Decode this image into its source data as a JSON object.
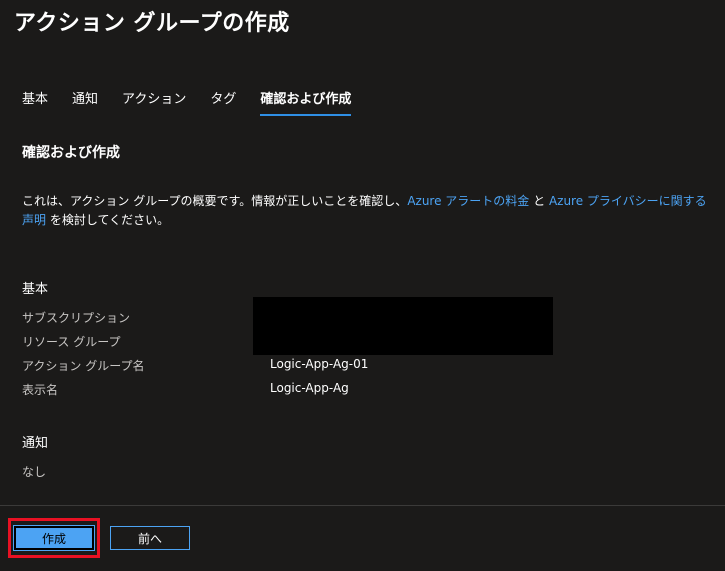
{
  "header": {
    "title": "アクション グループの作成"
  },
  "tabs": [
    {
      "label": "基本",
      "active": false
    },
    {
      "label": "通知",
      "active": false
    },
    {
      "label": "アクション",
      "active": false
    },
    {
      "label": "タグ",
      "active": false
    },
    {
      "label": "確認および作成",
      "active": true
    }
  ],
  "section": {
    "heading": "確認および作成"
  },
  "description": {
    "part1": "これは、アクション グループの概要です。情報が正しいことを確認し、",
    "link1": "Azure アラートの料金",
    "part2": " と ",
    "link2": "Azure プライバシーに関する声明",
    "part3": " を検討してください。"
  },
  "basics": {
    "title": "基本",
    "fields": [
      {
        "label": "サブスクリプション",
        "value": ""
      },
      {
        "label": "リソース グループ",
        "value": ""
      },
      {
        "label": "アクション グループ名",
        "value": "Logic-App-Ag-01"
      },
      {
        "label": "表示名",
        "value": "Logic-App-Ag"
      }
    ]
  },
  "notifications": {
    "title": "通知",
    "value": "なし"
  },
  "footer": {
    "create_label": "作成",
    "previous_label": "前へ"
  },
  "colors": {
    "accent": "#4ca3f3",
    "highlight": "#e81123",
    "background": "#1b1a19"
  }
}
